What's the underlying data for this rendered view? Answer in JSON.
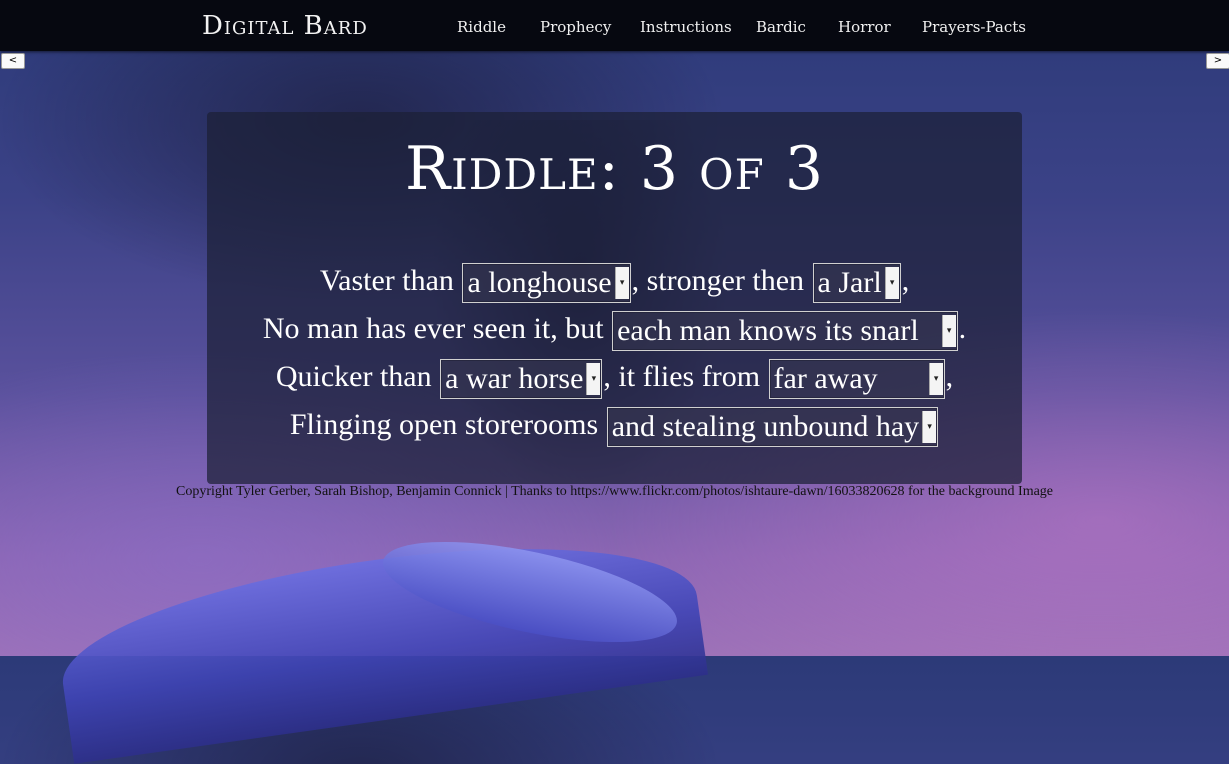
{
  "brand": "Digital Bard",
  "nav": [
    "Riddle",
    "Prophecy",
    "Instructions",
    "Bardic",
    "Horror",
    "Prayers-Pacts"
  ],
  "prev_label": "<",
  "next_label": ">",
  "riddle": {
    "title": "Riddle: 3 of 3",
    "line1": {
      "pre": "Vaster than",
      "sel1": "a longhouse",
      "mid": ", stronger then",
      "sel2": "a Jarl",
      "post": ","
    },
    "line2": {
      "pre": "No man has ever seen it, but",
      "sel1": "each man knows its snarl",
      "post": "."
    },
    "line3": {
      "pre": "Quicker than",
      "sel1": "a war horse",
      "mid": ", it flies from",
      "sel2": "far away",
      "post": ","
    },
    "line4": {
      "pre": "Flinging open storerooms",
      "sel1": "and stealing unbound hay",
      "post": ""
    }
  },
  "footer": "Copyright Tyler Gerber, Sarah Bishop, Benjamin Connick | Thanks to https://www.flickr.com/photos/ishtaure-dawn/16033820628 for the background Image",
  "icons": {
    "select_caret": "caret-down-icon"
  }
}
